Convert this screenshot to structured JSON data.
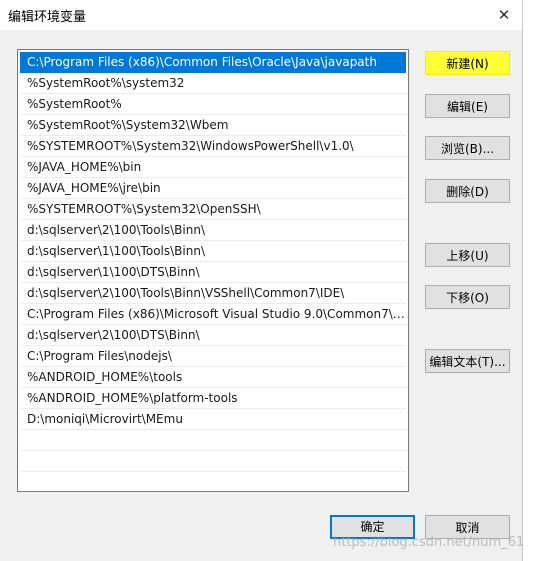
{
  "window": {
    "title": "编辑环境变量",
    "close_glyph": "✕"
  },
  "paths": [
    "C:\\Program Files (x86)\\Common Files\\Oracle\\Java\\javapath",
    "%SystemRoot%\\system32",
    "%SystemRoot%",
    "%SystemRoot%\\System32\\Wbem",
    "%SYSTEMROOT%\\System32\\WindowsPowerShell\\v1.0\\",
    "%JAVA_HOME%\\bin",
    "%JAVA_HOME%\\jre\\bin",
    "%SYSTEMROOT%\\System32\\OpenSSH\\",
    "d:\\sqlserver\\2\\100\\Tools\\Binn\\",
    "d:\\sqlserver\\1\\100\\Tools\\Binn\\",
    "d:\\sqlserver\\1\\100\\DTS\\Binn\\",
    "d:\\sqlserver\\2\\100\\Tools\\Binn\\VSShell\\Common7\\IDE\\",
    "C:\\Program Files (x86)\\Microsoft Visual Studio 9.0\\Common7\\I...",
    "d:\\sqlserver\\2\\100\\DTS\\Binn\\",
    "C:\\Program Files\\nodejs\\",
    "%ANDROID_HOME%\\tools",
    "%ANDROID_HOME%\\platform-tools",
    "D:\\moniqi\\Microvirt\\MEmu"
  ],
  "selected_index": 0,
  "buttons": {
    "new": "新建(N)",
    "edit": "编辑(E)",
    "browse": "浏览(B)...",
    "delete": "删除(D)",
    "move_up": "上移(U)",
    "move_down": "下移(O)",
    "edit_text": "编辑文本(T)...",
    "ok": "确定",
    "cancel": "取消"
  },
  "colors": {
    "selection": "#0078d7",
    "highlight": "#ffff33"
  },
  "watermark": "https://blog.csdn.net/num_61"
}
